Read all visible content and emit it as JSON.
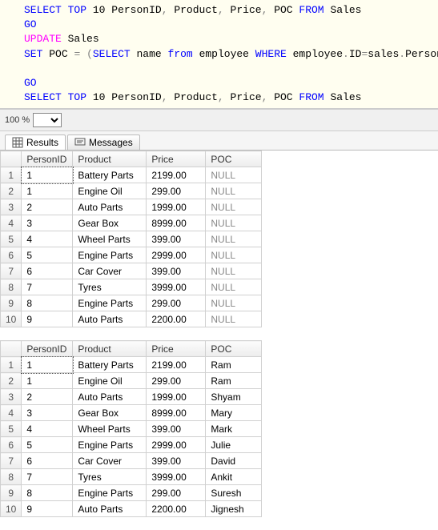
{
  "sql": {
    "line1_pre": "SELECT",
    "line1_top": "TOP",
    "line1_num": "10",
    "line1_cols": "PersonID",
    "line1_comma1": ",",
    "line1_col2": "Product",
    "line1_comma2": ",",
    "line1_col3": "Price",
    "line1_comma3": ",",
    "line1_col4": "POC",
    "line1_from": "FROM",
    "line1_tbl": "Sales",
    "line2": "GO",
    "line3_update": "UPDATE",
    "line3_tbl": "Sales",
    "line4_set": "SET",
    "line4_col": "POC",
    "line4_eq": "=",
    "line4_lpar": "(",
    "line4_select": "SELECT",
    "line4_name": "name",
    "line4_from": "from",
    "line4_emp": "employee",
    "line4_where": "WHERE",
    "line4_cond1": "employee",
    "line4_dot1": ".",
    "line4_id": "ID",
    "line4_eq2": "=",
    "line4_cond2": "sales",
    "line4_dot2": ".",
    "line4_pid": "PersonID",
    "line4_rpar": ")",
    "line6": "GO",
    "line7_pre": "SELECT",
    "line7_top": "TOP",
    "line7_num": "10",
    "line7_cols": "PersonID",
    "line7_comma1": ",",
    "line7_col2": "Product",
    "line7_comma2": ",",
    "line7_col3": "Price",
    "line7_comma3": ",",
    "line7_col4": "POC",
    "line7_from": "FROM",
    "line7_tbl": "Sales"
  },
  "zoom": {
    "value": "100 %"
  },
  "tabs": {
    "results": "Results",
    "messages": "Messages"
  },
  "headers": {
    "person": "PersonID",
    "product": "Product",
    "price": "Price",
    "poc": "POC"
  },
  "grid1": [
    {
      "n": "1",
      "person": "1",
      "product": "Battery Parts",
      "price": "2199.00",
      "poc": "NULL"
    },
    {
      "n": "2",
      "person": "1",
      "product": "Engine Oil",
      "price": "299.00",
      "poc": "NULL"
    },
    {
      "n": "3",
      "person": "2",
      "product": "Auto Parts",
      "price": "1999.00",
      "poc": "NULL"
    },
    {
      "n": "4",
      "person": "3",
      "product": "Gear Box",
      "price": "8999.00",
      "poc": "NULL"
    },
    {
      "n": "5",
      "person": "4",
      "product": "Wheel Parts",
      "price": "399.00",
      "poc": "NULL"
    },
    {
      "n": "6",
      "person": "5",
      "product": "Engine Parts",
      "price": "2999.00",
      "poc": "NULL"
    },
    {
      "n": "7",
      "person": "6",
      "product": "Car Cover",
      "price": "399.00",
      "poc": "NULL"
    },
    {
      "n": "8",
      "person": "7",
      "product": "Tyres",
      "price": "3999.00",
      "poc": "NULL"
    },
    {
      "n": "9",
      "person": "8",
      "product": "Engine Parts",
      "price": "299.00",
      "poc": "NULL"
    },
    {
      "n": "10",
      "person": "9",
      "product": "Auto Parts",
      "price": "2200.00",
      "poc": "NULL"
    }
  ],
  "grid2": [
    {
      "n": "1",
      "person": "1",
      "product": "Battery Parts",
      "price": "2199.00",
      "poc": "Ram"
    },
    {
      "n": "2",
      "person": "1",
      "product": "Engine Oil",
      "price": "299.00",
      "poc": "Ram"
    },
    {
      "n": "3",
      "person": "2",
      "product": "Auto Parts",
      "price": "1999.00",
      "poc": "Shyam"
    },
    {
      "n": "4",
      "person": "3",
      "product": "Gear Box",
      "price": "8999.00",
      "poc": "Mary"
    },
    {
      "n": "5",
      "person": "4",
      "product": "Wheel Parts",
      "price": "399.00",
      "poc": "Mark"
    },
    {
      "n": "6",
      "person": "5",
      "product": "Engine Parts",
      "price": "2999.00",
      "poc": "Julie"
    },
    {
      "n": "7",
      "person": "6",
      "product": "Car Cover",
      "price": "399.00",
      "poc": "David"
    },
    {
      "n": "8",
      "person": "7",
      "product": "Tyres",
      "price": "3999.00",
      "poc": "Ankit"
    },
    {
      "n": "9",
      "person": "8",
      "product": "Engine Parts",
      "price": "299.00",
      "poc": "Suresh"
    },
    {
      "n": "10",
      "person": "9",
      "product": "Auto Parts",
      "price": "2200.00",
      "poc": "Jignesh"
    }
  ]
}
